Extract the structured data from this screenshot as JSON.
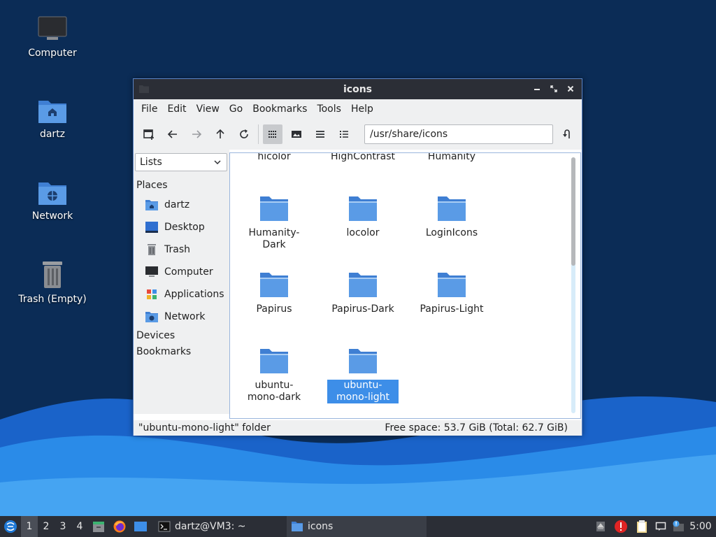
{
  "desktop": {
    "icons": [
      {
        "label": "Computer",
        "icon": "monitor-icon"
      },
      {
        "label": "dartz",
        "icon": "home-folder-icon"
      },
      {
        "label": "Network",
        "icon": "network-folder-icon"
      },
      {
        "label": "Trash (Empty)",
        "icon": "trash-icon"
      }
    ]
  },
  "window": {
    "title": "icons",
    "menu": [
      "File",
      "Edit",
      "View",
      "Go",
      "Bookmarks",
      "Tools",
      "Help"
    ],
    "toolbar": {
      "buttons": [
        "new-tab-icon",
        "back-arrow-icon",
        "forward-arrow-icon",
        "up-arrow-icon",
        "reload-icon",
        "icon-view-icon",
        "thumbnail-view-icon",
        "compact-view-icon",
        "detailed-list-icon"
      ],
      "path": "/usr/share/icons"
    },
    "sidebar": {
      "mode": "Lists",
      "places_label": "Places",
      "places": [
        {
          "label": "dartz",
          "icon": "home-folder-icon"
        },
        {
          "label": "Desktop",
          "icon": "desktop-icon"
        },
        {
          "label": "Trash",
          "icon": "trash-icon"
        },
        {
          "label": "Computer",
          "icon": "monitor-icon"
        },
        {
          "label": "Applications",
          "icon": "applications-icon"
        },
        {
          "label": "Network",
          "icon": "network-folder-icon"
        }
      ],
      "devices_label": "Devices",
      "bookmarks_label": "Bookmarks"
    },
    "files_partial": [
      "hicolor",
      "HighContrast",
      "Humanity"
    ],
    "files": [
      {
        "name": "Humanity-Dark"
      },
      {
        "name": "locolor"
      },
      {
        "name": "LoginIcons"
      },
      {
        "name": "Papirus"
      },
      {
        "name": "Papirus-Dark"
      },
      {
        "name": "Papirus-Light"
      },
      {
        "name": "ubuntu-mono-dark"
      },
      {
        "name": "ubuntu-mono-light",
        "selected": true
      }
    ],
    "status": {
      "left": "\"ubuntu-mono-light\" folder",
      "right": "Free space: 53.7 GiB (Total: 62.7 GiB)"
    }
  },
  "taskbar": {
    "workspaces": [
      "1",
      "2",
      "3",
      "4"
    ],
    "active_workspace": "1",
    "tasks": [
      {
        "label": "dartz@VM3: ~",
        "icon": "terminal-icon"
      },
      {
        "label": "icons",
        "icon": "folder-icon"
      }
    ],
    "clock": "5:00"
  },
  "colors": {
    "accent": "#3d8ee8",
    "folder": "#4a8ee0",
    "panel": "#2b2e36"
  }
}
